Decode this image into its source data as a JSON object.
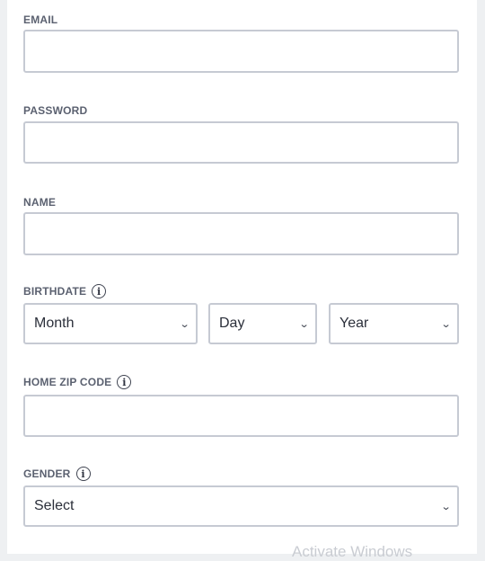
{
  "form": {
    "email": {
      "label": "EMAIL",
      "value": "",
      "placeholder": ""
    },
    "password": {
      "label": "PASSWORD",
      "value": "",
      "placeholder": ""
    },
    "name": {
      "label": "NAME",
      "value": "",
      "placeholder": ""
    },
    "birthdate": {
      "label": "BIRTHDATE",
      "info_icon": "info-icon",
      "month": "Month",
      "day": "Day",
      "year": "Year"
    },
    "zip": {
      "label": "HOME ZIP CODE",
      "info_icon": "info-icon",
      "value": "",
      "placeholder": ""
    },
    "gender": {
      "label": "GENDER",
      "info_icon": "info-icon",
      "selected": "Select"
    }
  },
  "watermark": "Activate Windows",
  "colors": {
    "border": "#c6cad3",
    "label": "#5b6170",
    "background": "#eef0f2"
  }
}
